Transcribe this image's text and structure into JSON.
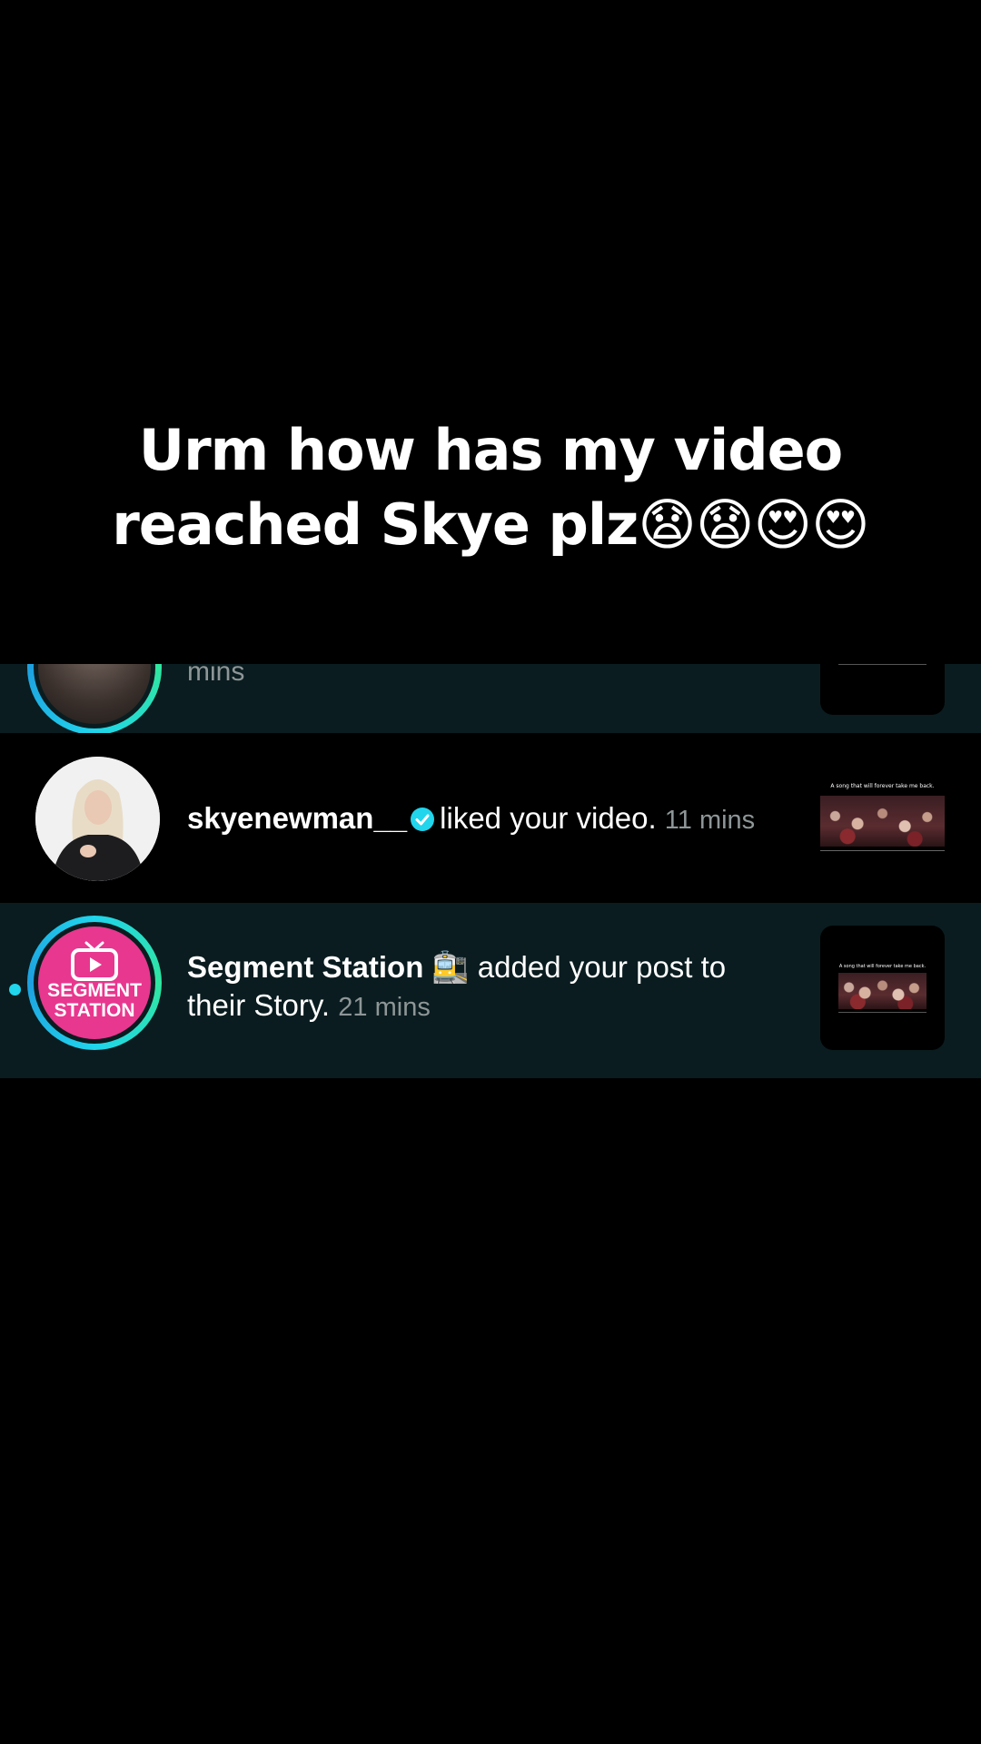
{
  "caption": {
    "line1": "Urm how has my video",
    "line2_text": "reached Skye plz",
    "line2_emojis": "😧😧😍😍"
  },
  "notifications": [
    {
      "partial_text": "mins"
    },
    {
      "username": "skyenewman__",
      "verified": true,
      "message": "liked your video.",
      "time": "11 mins",
      "thumb_caption": "A song that will forever take me back."
    },
    {
      "username": "Segment Station",
      "username_emoji": "🚉",
      "message_line1": "added your post to",
      "message_line2": "their Story.",
      "time": "21 mins",
      "avatar_brand_line1": "SEGMENT",
      "avatar_brand_line2": "STATION",
      "thumb_caption": "A song that will forever take me back.",
      "unread": true
    }
  ],
  "colors": {
    "background": "#000000",
    "highlight_row": "#0a1c1f",
    "story_ring": "#20d5ec",
    "verified_badge": "#20d5ec",
    "brand_pink": "#e8378e",
    "time_text": "#8e9697"
  },
  "icons": [
    "verified-badge-icon",
    "tv-play-icon",
    "unread-dot"
  ]
}
